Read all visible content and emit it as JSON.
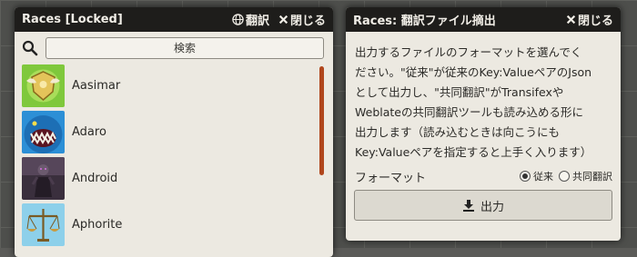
{
  "left_window": {
    "title": "Races [Locked]",
    "translate_label": "翻訳",
    "close_label": "閉じる",
    "search_label": "検索",
    "races": [
      {
        "name": "Aasimar",
        "avatar_icon": "aasimar-shield-avatar"
      },
      {
        "name": "Adaro",
        "avatar_icon": "adaro-shark-avatar"
      },
      {
        "name": "Android",
        "avatar_icon": "android-figure-avatar"
      },
      {
        "name": "Aphorite",
        "avatar_icon": "aphorite-scales-avatar"
      }
    ]
  },
  "right_window": {
    "title": "Races: 翻訳ファイル摘出",
    "close_label": "閉じる",
    "description_lines": [
      "出力するファイルのフォーマットを選んでく",
      "ださい。\"従来\"が従来のKey:ValueペアのJson",
      "として出力し、\"共同翻訳\"がTransifexや",
      "Weblateの共同翻訳ツールも読み込める形に",
      "出力します（読み込むときは向こうにも",
      "Key:Valueペアを指定すると上手く入ります）"
    ],
    "format_label": "フォーマット",
    "format_options": [
      {
        "label": "従来",
        "selected": true
      },
      {
        "label": "共同翻訳",
        "selected": false
      }
    ],
    "export_label": "出力"
  },
  "colors": {
    "titlebar": "#1e1d1b",
    "panel": "#ece9e1",
    "scrollbar": "#b0461c"
  }
}
